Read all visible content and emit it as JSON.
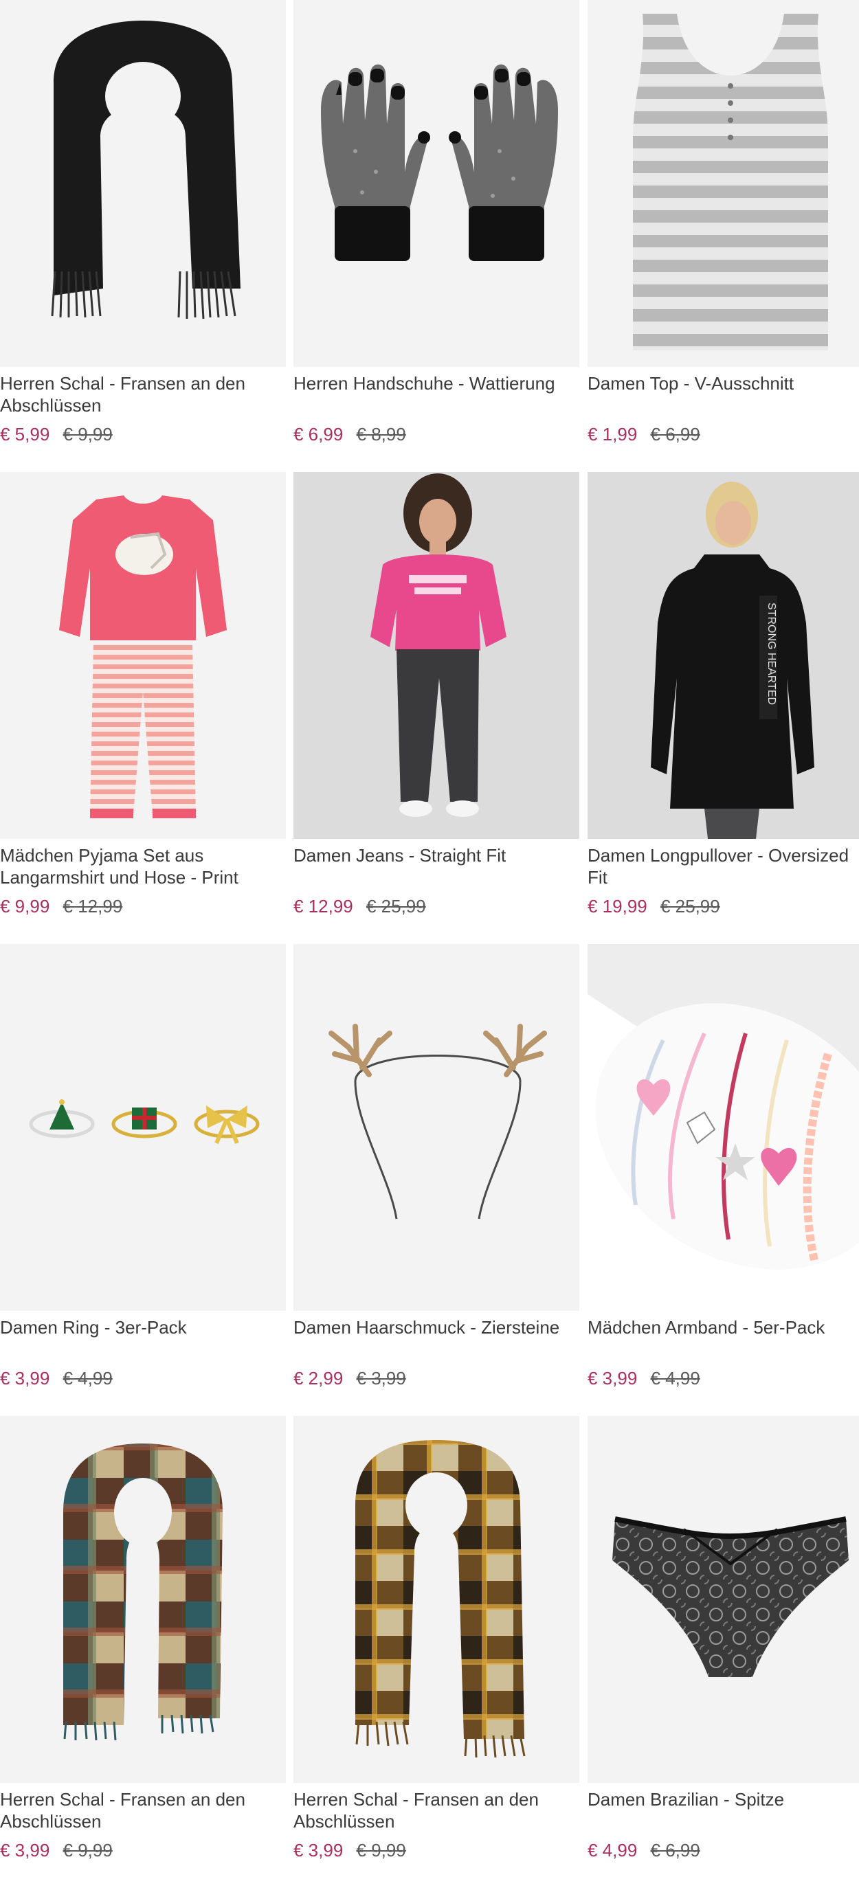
{
  "products": [
    {
      "title": "Herren Schal - Fransen an den Abschlüssen",
      "price": "€ 5,99",
      "old_price": "€ 9,99",
      "image_icon": "black-fringed-scarf-icon"
    },
    {
      "title": "Herren Handschuhe - Wattierung",
      "price": "€ 6,99",
      "old_price": "€ 8,99",
      "image_icon": "knit-gloves-icon"
    },
    {
      "title": "Damen Top - V-Ausschnitt",
      "price": "€ 1,99",
      "old_price": "€ 6,99",
      "image_icon": "striped-tank-top-icon"
    },
    {
      "title": "Mädchen Pyjama Set aus Langarmshirt und Hose - Print",
      "price": "€ 9,99",
      "old_price": "€ 12,99",
      "image_icon": "pink-pyjama-set-icon"
    },
    {
      "title": "Damen Jeans - Straight Fit",
      "price": "€ 12,99",
      "old_price": "€ 25,99",
      "image_icon": "model-pink-sweater-jeans-icon"
    },
    {
      "title": "Damen Longpullover - Oversized Fit",
      "price": "€ 19,99",
      "old_price": "€ 25,99",
      "image_icon": "model-black-longpullover-icon"
    },
    {
      "title": "Damen Ring - 3er-Pack",
      "price": "€ 3,99",
      "old_price": "€ 4,99",
      "image_icon": "christmas-rings-icon"
    },
    {
      "title": "Damen Haarschmuck - Ziersteine",
      "price": "€ 2,99",
      "old_price": "€ 3,99",
      "image_icon": "antler-headband-icon"
    },
    {
      "title": "Mädchen Armband - 5er-Pack",
      "price": "€ 3,99",
      "old_price": "€ 4,99",
      "image_icon": "bracelets-icon"
    },
    {
      "title": "Herren Schal - Fransen an den Abschlüssen",
      "price": "€ 3,99",
      "old_price": "€ 9,99",
      "image_icon": "plaid-scarf-blue-icon"
    },
    {
      "title": "Herren Schal - Fransen an den Abschlüssen",
      "price": "€ 3,99",
      "old_price": "€ 9,99",
      "image_icon": "plaid-scarf-brown-icon"
    },
    {
      "title": "Damen Brazilian - Spitze",
      "price": "€ 4,99",
      "old_price": "€ 6,99",
      "image_icon": "lace-brazilian-icon"
    }
  ],
  "colors": {
    "price_current": "#a8305e",
    "price_old": "#5a5a5a",
    "text": "#3a3a3a",
    "tile_background": "#f3f3f3"
  }
}
